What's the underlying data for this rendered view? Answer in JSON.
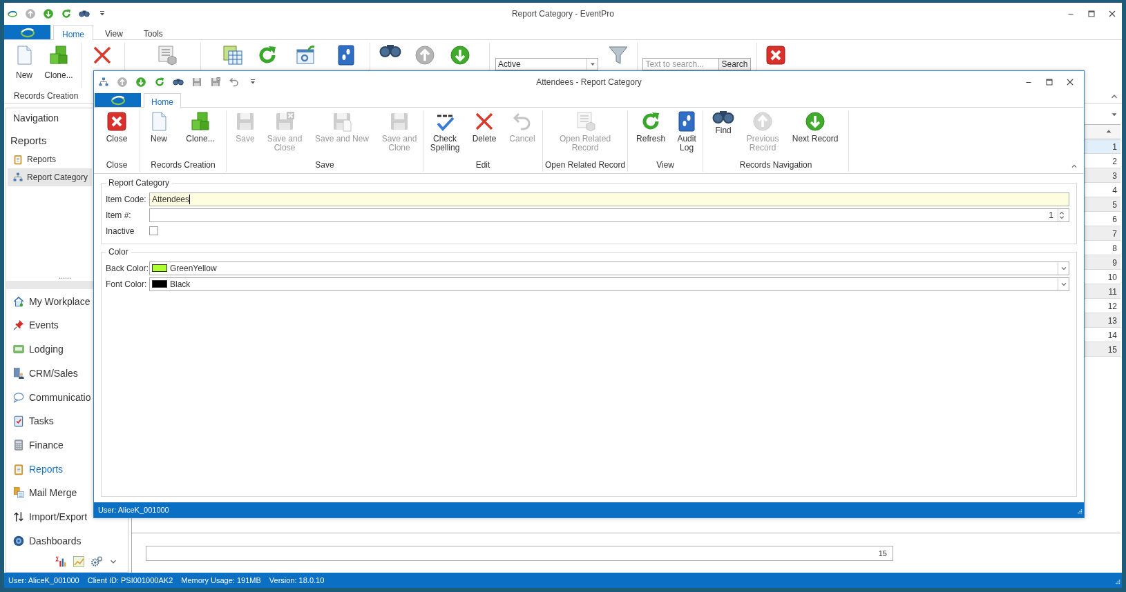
{
  "main_window": {
    "title": "Report Category - EventPro",
    "tabs": [
      {
        "label": "Home",
        "selected": true
      },
      {
        "label": "View",
        "selected": false
      },
      {
        "label": "Tools",
        "selected": false
      }
    ],
    "ribbon": {
      "buttons": [
        {
          "label": "New"
        },
        {
          "label": "Clone..."
        }
      ],
      "group_label": "Records Creation",
      "status_filter": "Active",
      "search": {
        "placeholder": "Text to search...",
        "button": "Search"
      }
    },
    "navigation": {
      "title": "Navigation",
      "section": "Reports",
      "items": [
        {
          "label": "Reports",
          "selected": false
        },
        {
          "label": "Report Category",
          "selected": true
        }
      ],
      "modules": [
        {
          "label": "My Workplace",
          "selected": false
        },
        {
          "label": "Events",
          "selected": false
        },
        {
          "label": "Lodging",
          "selected": false
        },
        {
          "label": "CRM/Sales",
          "selected": false
        },
        {
          "label": "Communicatio",
          "selected": false
        },
        {
          "label": "Tasks",
          "selected": false
        },
        {
          "label": "Finance",
          "selected": false
        },
        {
          "label": "Reports",
          "selected": true
        },
        {
          "label": "Mail Merge",
          "selected": false
        },
        {
          "label": "Import/Export",
          "selected": false
        },
        {
          "label": "Dashboards",
          "selected": false
        }
      ]
    },
    "grid": {
      "rows": [
        {
          "number": "1",
          "selected": true
        },
        {
          "number": "2",
          "selected": false
        },
        {
          "number": "3",
          "selected": false
        },
        {
          "number": "4",
          "selected": false
        },
        {
          "number": "5",
          "selected": false
        },
        {
          "number": "6",
          "selected": false
        },
        {
          "number": "7",
          "selected": false
        },
        {
          "number": "8",
          "selected": false
        },
        {
          "number": "9",
          "selected": false
        },
        {
          "number": "10",
          "selected": false
        },
        {
          "number": "11",
          "selected": false
        },
        {
          "number": "12",
          "selected": false
        },
        {
          "number": "13",
          "selected": false
        },
        {
          "number": "14",
          "selected": false
        },
        {
          "number": "15",
          "selected": false
        }
      ],
      "footer_value": "15"
    },
    "status_bar": [
      "User: AliceK_001000",
      "Client ID: PSI001000AK2",
      "Memory Usage: 191MB",
      "Version: 18.0.10"
    ]
  },
  "record_window": {
    "title": "Attendees - Report Category",
    "tabs": [
      {
        "label": "Home",
        "selected": true
      }
    ],
    "ribbon_groups": [
      {
        "label": "Close",
        "buttons": [
          {
            "label": "Close",
            "disabled": false
          }
        ]
      },
      {
        "label": "Records Creation",
        "buttons": [
          {
            "label": "New",
            "disabled": false
          },
          {
            "label": "Clone...",
            "disabled": false
          }
        ]
      },
      {
        "label": "Save",
        "buttons": [
          {
            "label": "Save",
            "disabled": true
          },
          {
            "label": "Save and Close",
            "disabled": true
          },
          {
            "label": "Save and New",
            "disabled": true
          },
          {
            "label": "Save and Clone",
            "disabled": true
          }
        ]
      },
      {
        "label": "Edit",
        "buttons": [
          {
            "label": "Check Spelling",
            "disabled": false
          },
          {
            "label": "Delete",
            "disabled": false
          },
          {
            "label": "Cancel",
            "disabled": true
          }
        ]
      },
      {
        "label": "Open Related Record",
        "buttons": [
          {
            "label": "Open Related Record",
            "disabled": true
          }
        ]
      },
      {
        "label": "View",
        "buttons": [
          {
            "label": "Refresh",
            "disabled": false
          },
          {
            "label": "Audit Log",
            "disabled": false
          }
        ]
      },
      {
        "label": "Records Navigation",
        "buttons": [
          {
            "label": "Find",
            "disabled": false
          },
          {
            "label": "Previous Record",
            "disabled": true
          },
          {
            "label": "Next Record",
            "disabled": false
          }
        ]
      }
    ],
    "sections": [
      {
        "title": "Report Category",
        "fields": [
          {
            "kind": "text",
            "label": "Item Code:",
            "value": "Attendees",
            "focused": true
          },
          {
            "kind": "number",
            "label": "Item #:",
            "value": "1",
            "focused": false
          },
          {
            "kind": "checkbox",
            "label": "Inactive",
            "checked": false
          }
        ]
      },
      {
        "title": "Color",
        "fields": [
          {
            "kind": "color",
            "label": "Back Color:",
            "value": "GreenYellow",
            "color": "#adff2f"
          },
          {
            "kind": "color",
            "label": "Font Color:",
            "value": "Black",
            "color": "#000000"
          }
        ]
      }
    ],
    "status_bar": "User: AliceK_001000"
  }
}
